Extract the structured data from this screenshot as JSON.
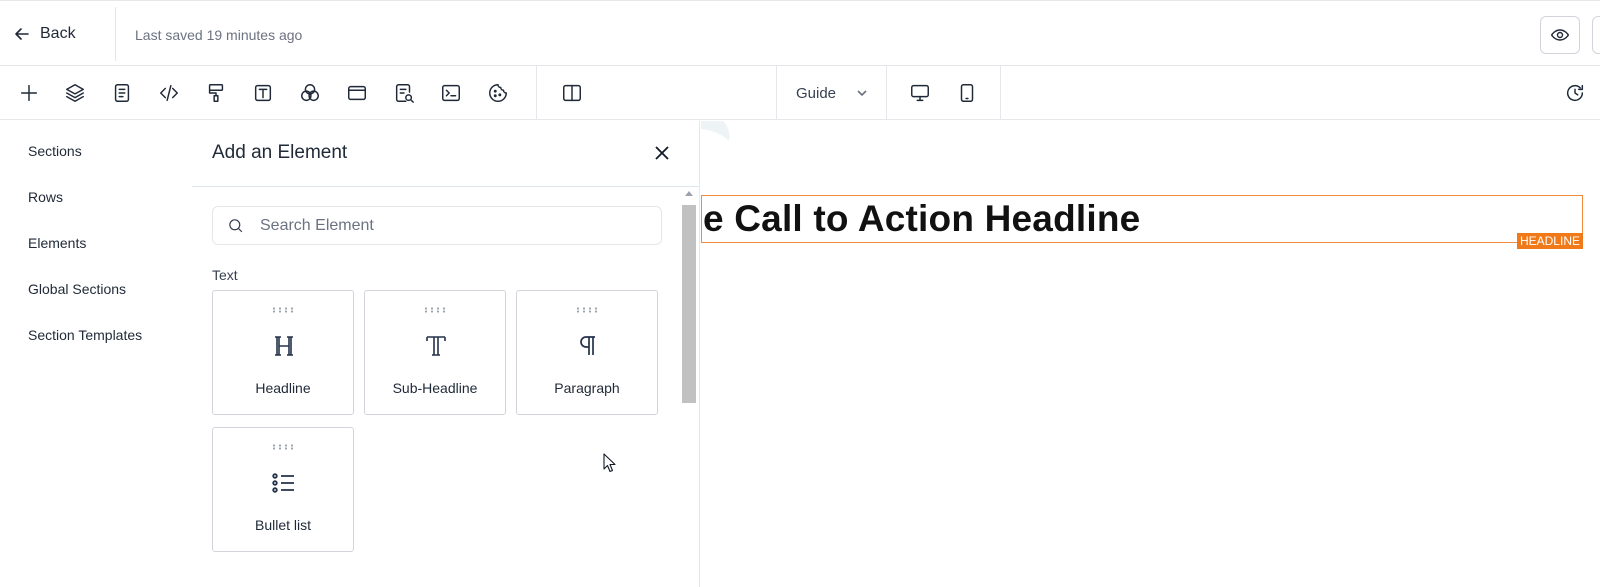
{
  "header": {
    "back_label": "Back",
    "last_saved": "Last saved 19 minutes ago"
  },
  "toolbar": {
    "tools": [
      "add-icon",
      "layers-icon",
      "page-icon",
      "code-icon",
      "paint-roller-icon",
      "text-box-icon",
      "color-circles-icon",
      "layout-icon",
      "search-page-icon",
      "terminal-icon",
      "cookie-icon",
      "split-view-icon"
    ],
    "guide_label": "Guide",
    "device_icons": [
      "desktop-icon",
      "mobile-icon"
    ],
    "history_icon": "history-icon"
  },
  "leftnav": {
    "items": [
      "Sections",
      "Rows",
      "Elements",
      "Global Sections",
      "Section Templates"
    ]
  },
  "panel": {
    "title": "Add an Element",
    "search_placeholder": "Search Element",
    "group_label": "Text",
    "cards": [
      {
        "label": "Headline",
        "icon": "headline-icon"
      },
      {
        "label": "Sub-Headline",
        "icon": "sub-headline-icon"
      },
      {
        "label": "Paragraph",
        "icon": "paragraph-icon"
      },
      {
        "label": "Bullet list",
        "icon": "bullet-list-icon"
      }
    ]
  },
  "canvas": {
    "headline_text": "e Call to Action Headline",
    "headline_badge": "HEADLINE",
    "selection_color": "#f08a3e",
    "badge_color": "#f07a1a"
  }
}
